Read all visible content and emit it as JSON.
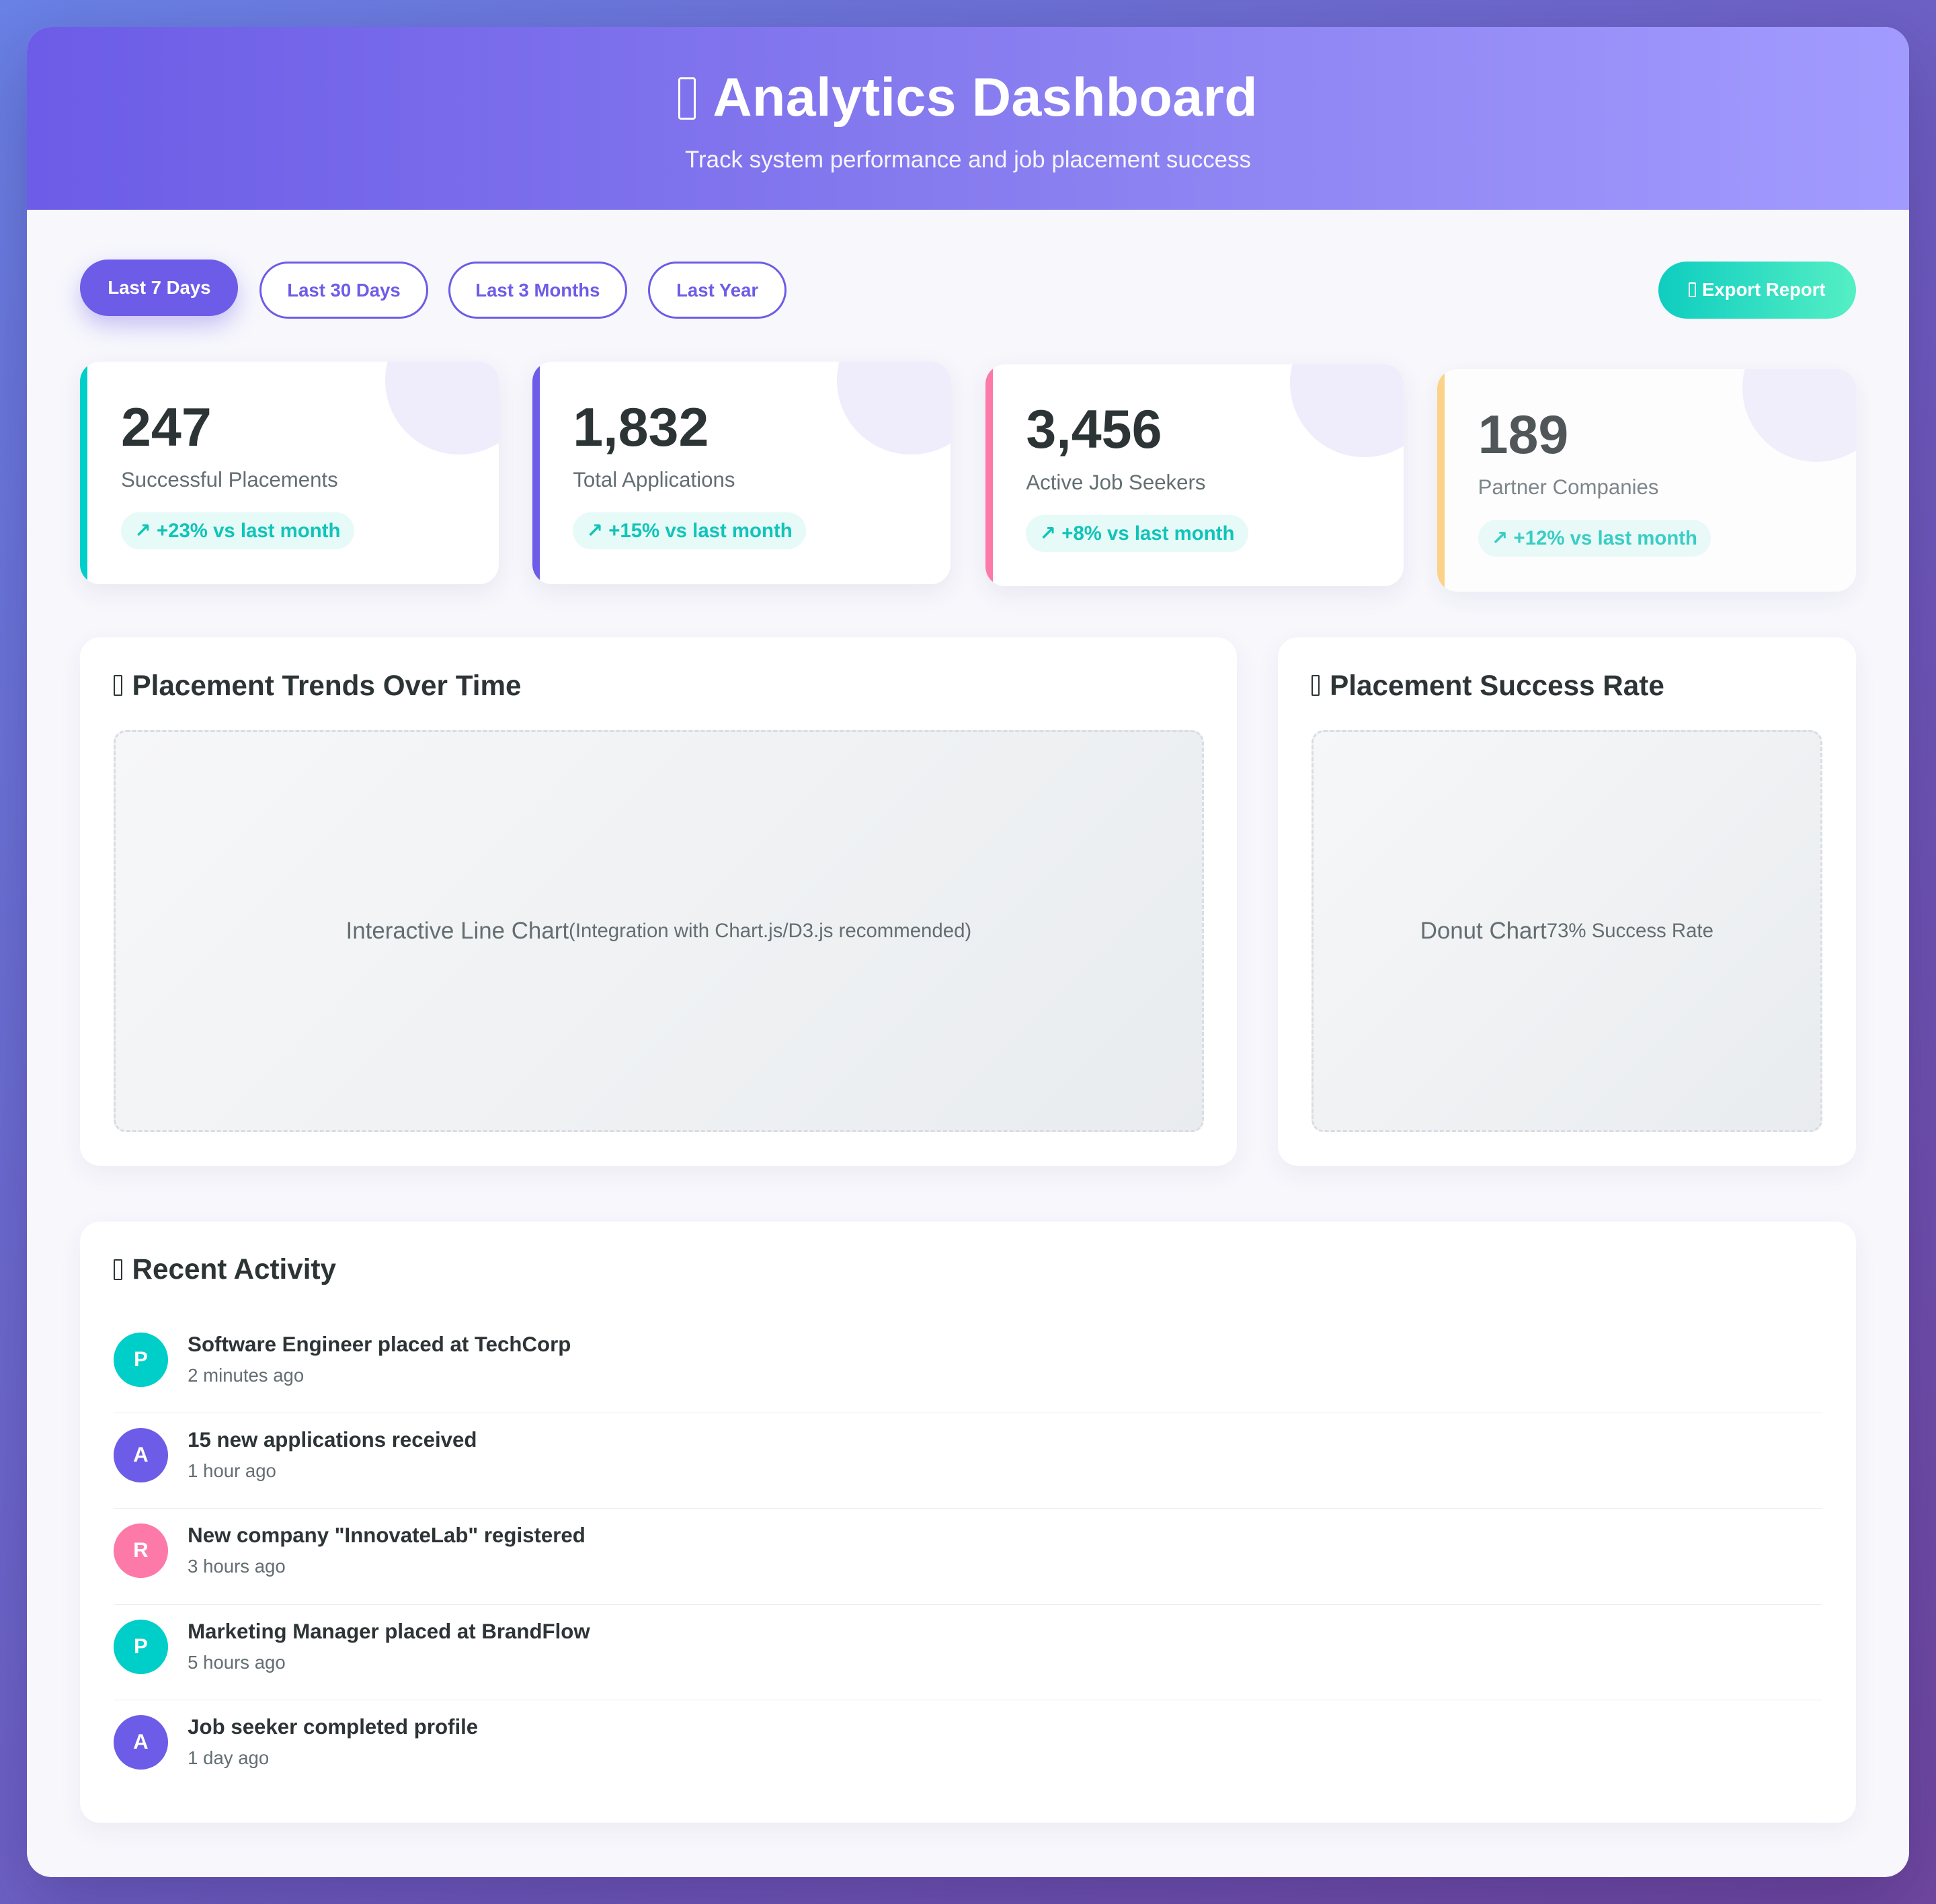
{
  "header": {
    "title": "Analytics Dashboard",
    "subtitle": "Track system performance and job placement success"
  },
  "filters": {
    "items": [
      "Last 7 Days",
      "Last 30 Days",
      "Last 3 Months",
      "Last Year"
    ],
    "active": "Last 7 Days"
  },
  "export_label": "Export Report",
  "colors": {
    "primary": "#6c5ce7",
    "teal": "#00cec9",
    "pink": "#fd79a8",
    "yellow": "#fdcb6e"
  },
  "stats": [
    {
      "value": "247",
      "label": "Successful Placements",
      "trend": "↗ +23% vs last month",
      "accent": "#00cec9"
    },
    {
      "value": "1,832",
      "label": "Total Applications",
      "trend": "↗ +15% vs last month",
      "accent": "#6c5ce7"
    },
    {
      "value": "3,456",
      "label": "Active Job Seekers",
      "trend": "↗ +8% vs last month",
      "accent": "#fd79a8"
    },
    {
      "value": "189",
      "label": "Partner Companies",
      "trend": "↗ +12% vs last month",
      "accent": "#fdcb6e"
    }
  ],
  "trends_card": {
    "title": "Placement Trends Over Time",
    "placeholder_main": "Interactive Line Chart",
    "placeholder_sub": "(Integration with Chart.js/D3.js recommended)"
  },
  "success_card": {
    "title": "Placement Success Rate",
    "placeholder_main": "Donut Chart",
    "placeholder_sub": "73% Success Rate"
  },
  "activity": {
    "title": "Recent Activity",
    "items": [
      {
        "initial": "P",
        "title": "Software Engineer placed at TechCorp",
        "time": "2 minutes ago",
        "color": "#00cec9"
      },
      {
        "initial": "A",
        "title": "15 new applications received",
        "time": "1 hour ago",
        "color": "#6c5ce7"
      },
      {
        "initial": "R",
        "title": "New company \"InnovateLab\" registered",
        "time": "3 hours ago",
        "color": "#fd79a8"
      },
      {
        "initial": "P",
        "title": "Marketing Manager placed at BrandFlow",
        "time": "5 hours ago",
        "color": "#00cec9"
      },
      {
        "initial": "A",
        "title": "Job seeker completed profile",
        "time": "1 day ago",
        "color": "#6c5ce7"
      }
    ]
  }
}
